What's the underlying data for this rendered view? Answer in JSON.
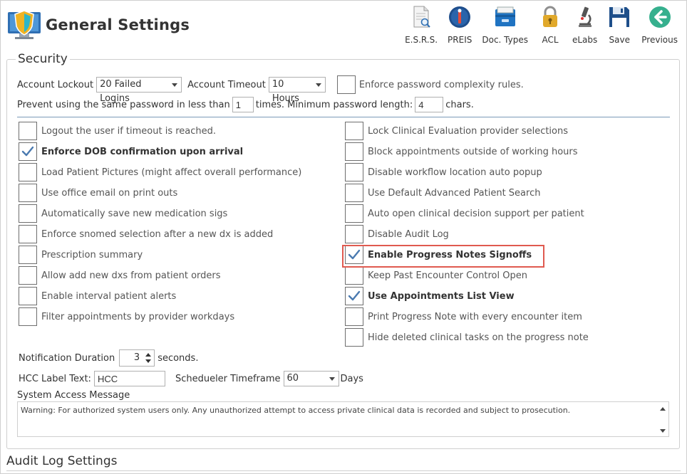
{
  "header": {
    "title": "General Settings",
    "logo_icon": "shield-monitor-logo"
  },
  "toolbar": [
    {
      "label": "E.S.R.S.",
      "icon": "document-search-icon"
    },
    {
      "label": "PREIS",
      "icon": "preis-icon"
    },
    {
      "label": "Doc. Types",
      "icon": "file-drawer-icon"
    },
    {
      "label": "ACL",
      "icon": "lock-icon"
    },
    {
      "label": "eLabs",
      "icon": "microscope-icon"
    },
    {
      "label": "Save",
      "icon": "save-icon"
    },
    {
      "label": "Previous",
      "icon": "back-arrow-icon"
    }
  ],
  "security": {
    "title": "Security",
    "account_lockout_label": "Account Lockout",
    "account_lockout_value": "20 Failed Logins",
    "account_timeout_label": "Account Timeout",
    "account_timeout_value": "10 Hours",
    "enforce_complexity_label": "Enforce password complexity rules.",
    "prevent_label": "Prevent using the same password in less than",
    "prevent_value": "1",
    "times_label": "times. Minimum password length:",
    "min_length_value": "4",
    "chars_label": "chars.",
    "left_options": [
      {
        "label": "Logout the user if timeout is reached.",
        "checked": false
      },
      {
        "label": "Enforce DOB confirmation upon arrival",
        "checked": true
      },
      {
        "label": "Load Patient Pictures (might affect overall performance)",
        "checked": false
      },
      {
        "label": "Use office email on print outs",
        "checked": false
      },
      {
        "label": "Automatically save new medication sigs",
        "checked": false
      },
      {
        "label": "Enforce snomed selection after a new dx is added",
        "checked": false
      },
      {
        "label": "Prescription summary",
        "checked": false
      },
      {
        "label": "Allow add new dxs from patient orders",
        "checked": false
      },
      {
        "label": "Enable interval patient alerts",
        "checked": false
      },
      {
        "label": "Filter appointments by provider workdays",
        "checked": false
      }
    ],
    "right_options": [
      {
        "label": "Lock Clinical Evaluation provider selections",
        "checked": false
      },
      {
        "label": "Block appointments outside of working hours",
        "checked": false
      },
      {
        "label": "Disable workflow location auto popup",
        "checked": false
      },
      {
        "label": "Use Default Advanced Patient Search",
        "checked": false
      },
      {
        "label": "Auto open clinical decision support per patient",
        "checked": false
      },
      {
        "label": "Disable Audit Log",
        "checked": false
      },
      {
        "label": "Enable Progress Notes Signoffs",
        "checked": true
      },
      {
        "label": "Keep Past Encounter Control Open",
        "checked": false
      },
      {
        "label": "Use Appointments List View",
        "checked": true
      },
      {
        "label": "Print Progress Note with every encounter item",
        "checked": false
      },
      {
        "label": "Hide deleted clinical tasks on the progress note",
        "checked": false
      }
    ],
    "notification_label": "Notification Duration",
    "notification_value": "3",
    "seconds_label": "seconds.",
    "hcc_label": "HCC Label Text:",
    "hcc_value": "HCC",
    "timeframe_label": "Schedueler Timeframe",
    "timeframe_value": "60",
    "days_label": "Days",
    "system_access_label": "System Access Message",
    "system_access_message": "Warning: For authorized system users only. Any unauthorized attempt to access private clinical data is recorded and subject to prosecution."
  },
  "audit": {
    "title": "Audit Log Settings"
  },
  "colors": {
    "check_blue": "#4a7ab0",
    "highlight_red": "#e05a4f",
    "divider_blue": "#7a9ab8"
  }
}
